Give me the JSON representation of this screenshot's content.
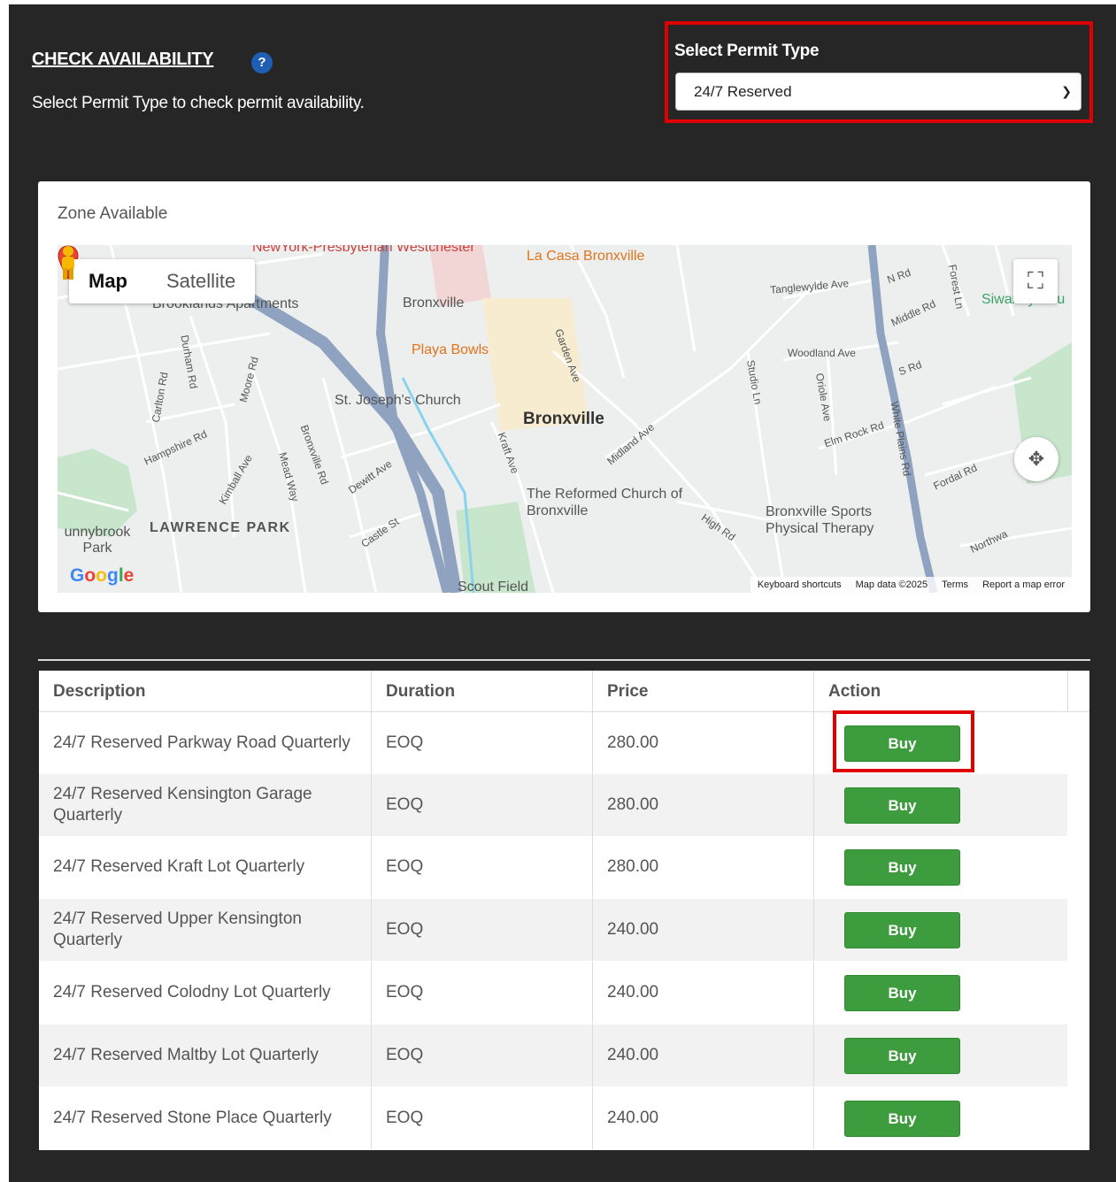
{
  "header": {
    "title": "CHECK AVAILABILITY",
    "help_icon": "?",
    "subtitle": "Select Permit Type to check permit availability."
  },
  "permit_type": {
    "label": "Select Permit Type",
    "selected": "24/7 Reserved"
  },
  "map": {
    "zone_label": "Zone Available",
    "toggle_map": "Map",
    "toggle_satellite": "Satellite",
    "footer": {
      "shortcuts": "Keyboard shortcuts",
      "data": "Map data ©2025",
      "terms": "Terms",
      "report": "Report a map error"
    },
    "labels": {
      "hospital": "NewYork-Presbyterian Westchester",
      "la_casa": "La Casa Bronxville",
      "brooklands": "Brooklands Apartments",
      "bronxville_station": "Bronxville",
      "playa_bowls": "Playa Bowls",
      "st_joseph": "St. Joseph's Church",
      "bronxville": "Bronxville",
      "reformed_church": "The Reformed Church of Bronxville",
      "lawrence_park": "LAWRENCE PARK",
      "sunnybrook": "unnybrook Park",
      "scout_field": "Scout Field",
      "sports_therapy": "Bronxville Sports Physical Therapy",
      "siwanoy": "Siwanoy Cou",
      "tanglewylde": "Tanglewylde Ave",
      "woodland": "Woodland Ave",
      "elm_rock": "Elm Rock Rd",
      "white_plains": "White Plains Rd",
      "midland": "Midland Ave",
      "garden": "Garden Ave",
      "kraft": "Kraft Ave",
      "dewitt": "Dewitt Ave",
      "castle": "Castle St",
      "kimball": "Kimball Ave",
      "hampshire": "Hampshire Rd",
      "mead": "Mead Way",
      "bronxville_rd": "Bronxville Rd",
      "durham": "Durham Rd",
      "moore": "Moore Rd",
      "carlton": "Carlton Rd",
      "fordal": "Fordal Rd",
      "high": "High Rd",
      "studio": "Studio Ln",
      "oriole": "Oriole Ave",
      "n_rd": "N Rd",
      "middle_rd": "Middle Rd",
      "s_rd": "S Rd",
      "forest": "Forest Ln",
      "northway": "Northwa"
    }
  },
  "table": {
    "headers": [
      "Description",
      "Duration",
      "Price",
      "Action"
    ],
    "rows": [
      {
        "description": "24/7 Reserved Parkway Road Quarterly",
        "duration": "EOQ",
        "price": "280.00",
        "action": "Buy"
      },
      {
        "description": "24/7 Reserved Kensington Garage Quarterly",
        "duration": "EOQ",
        "price": "280.00",
        "action": "Buy"
      },
      {
        "description": "24/7 Reserved Kraft Lot Quarterly",
        "duration": "EOQ",
        "price": "280.00",
        "action": "Buy"
      },
      {
        "description": "24/7 Reserved Upper Kensington Quarterly",
        "duration": "EOQ",
        "price": "240.00",
        "action": "Buy"
      },
      {
        "description": "24/7 Reserved Colodny Lot Quarterly",
        "duration": "EOQ",
        "price": "240.00",
        "action": "Buy"
      },
      {
        "description": "24/7 Reserved Maltby Lot Quarterly",
        "duration": "EOQ",
        "price": "240.00",
        "action": "Buy"
      },
      {
        "description": "24/7 Reserved Stone Place Quarterly",
        "duration": "EOQ",
        "price": "240.00",
        "action": "Buy"
      }
    ]
  },
  "colors": {
    "panel_bg": "#262626",
    "highlight": "#e00000",
    "buy_button": "#3d9c3d",
    "help_icon": "#1e5fb3"
  }
}
